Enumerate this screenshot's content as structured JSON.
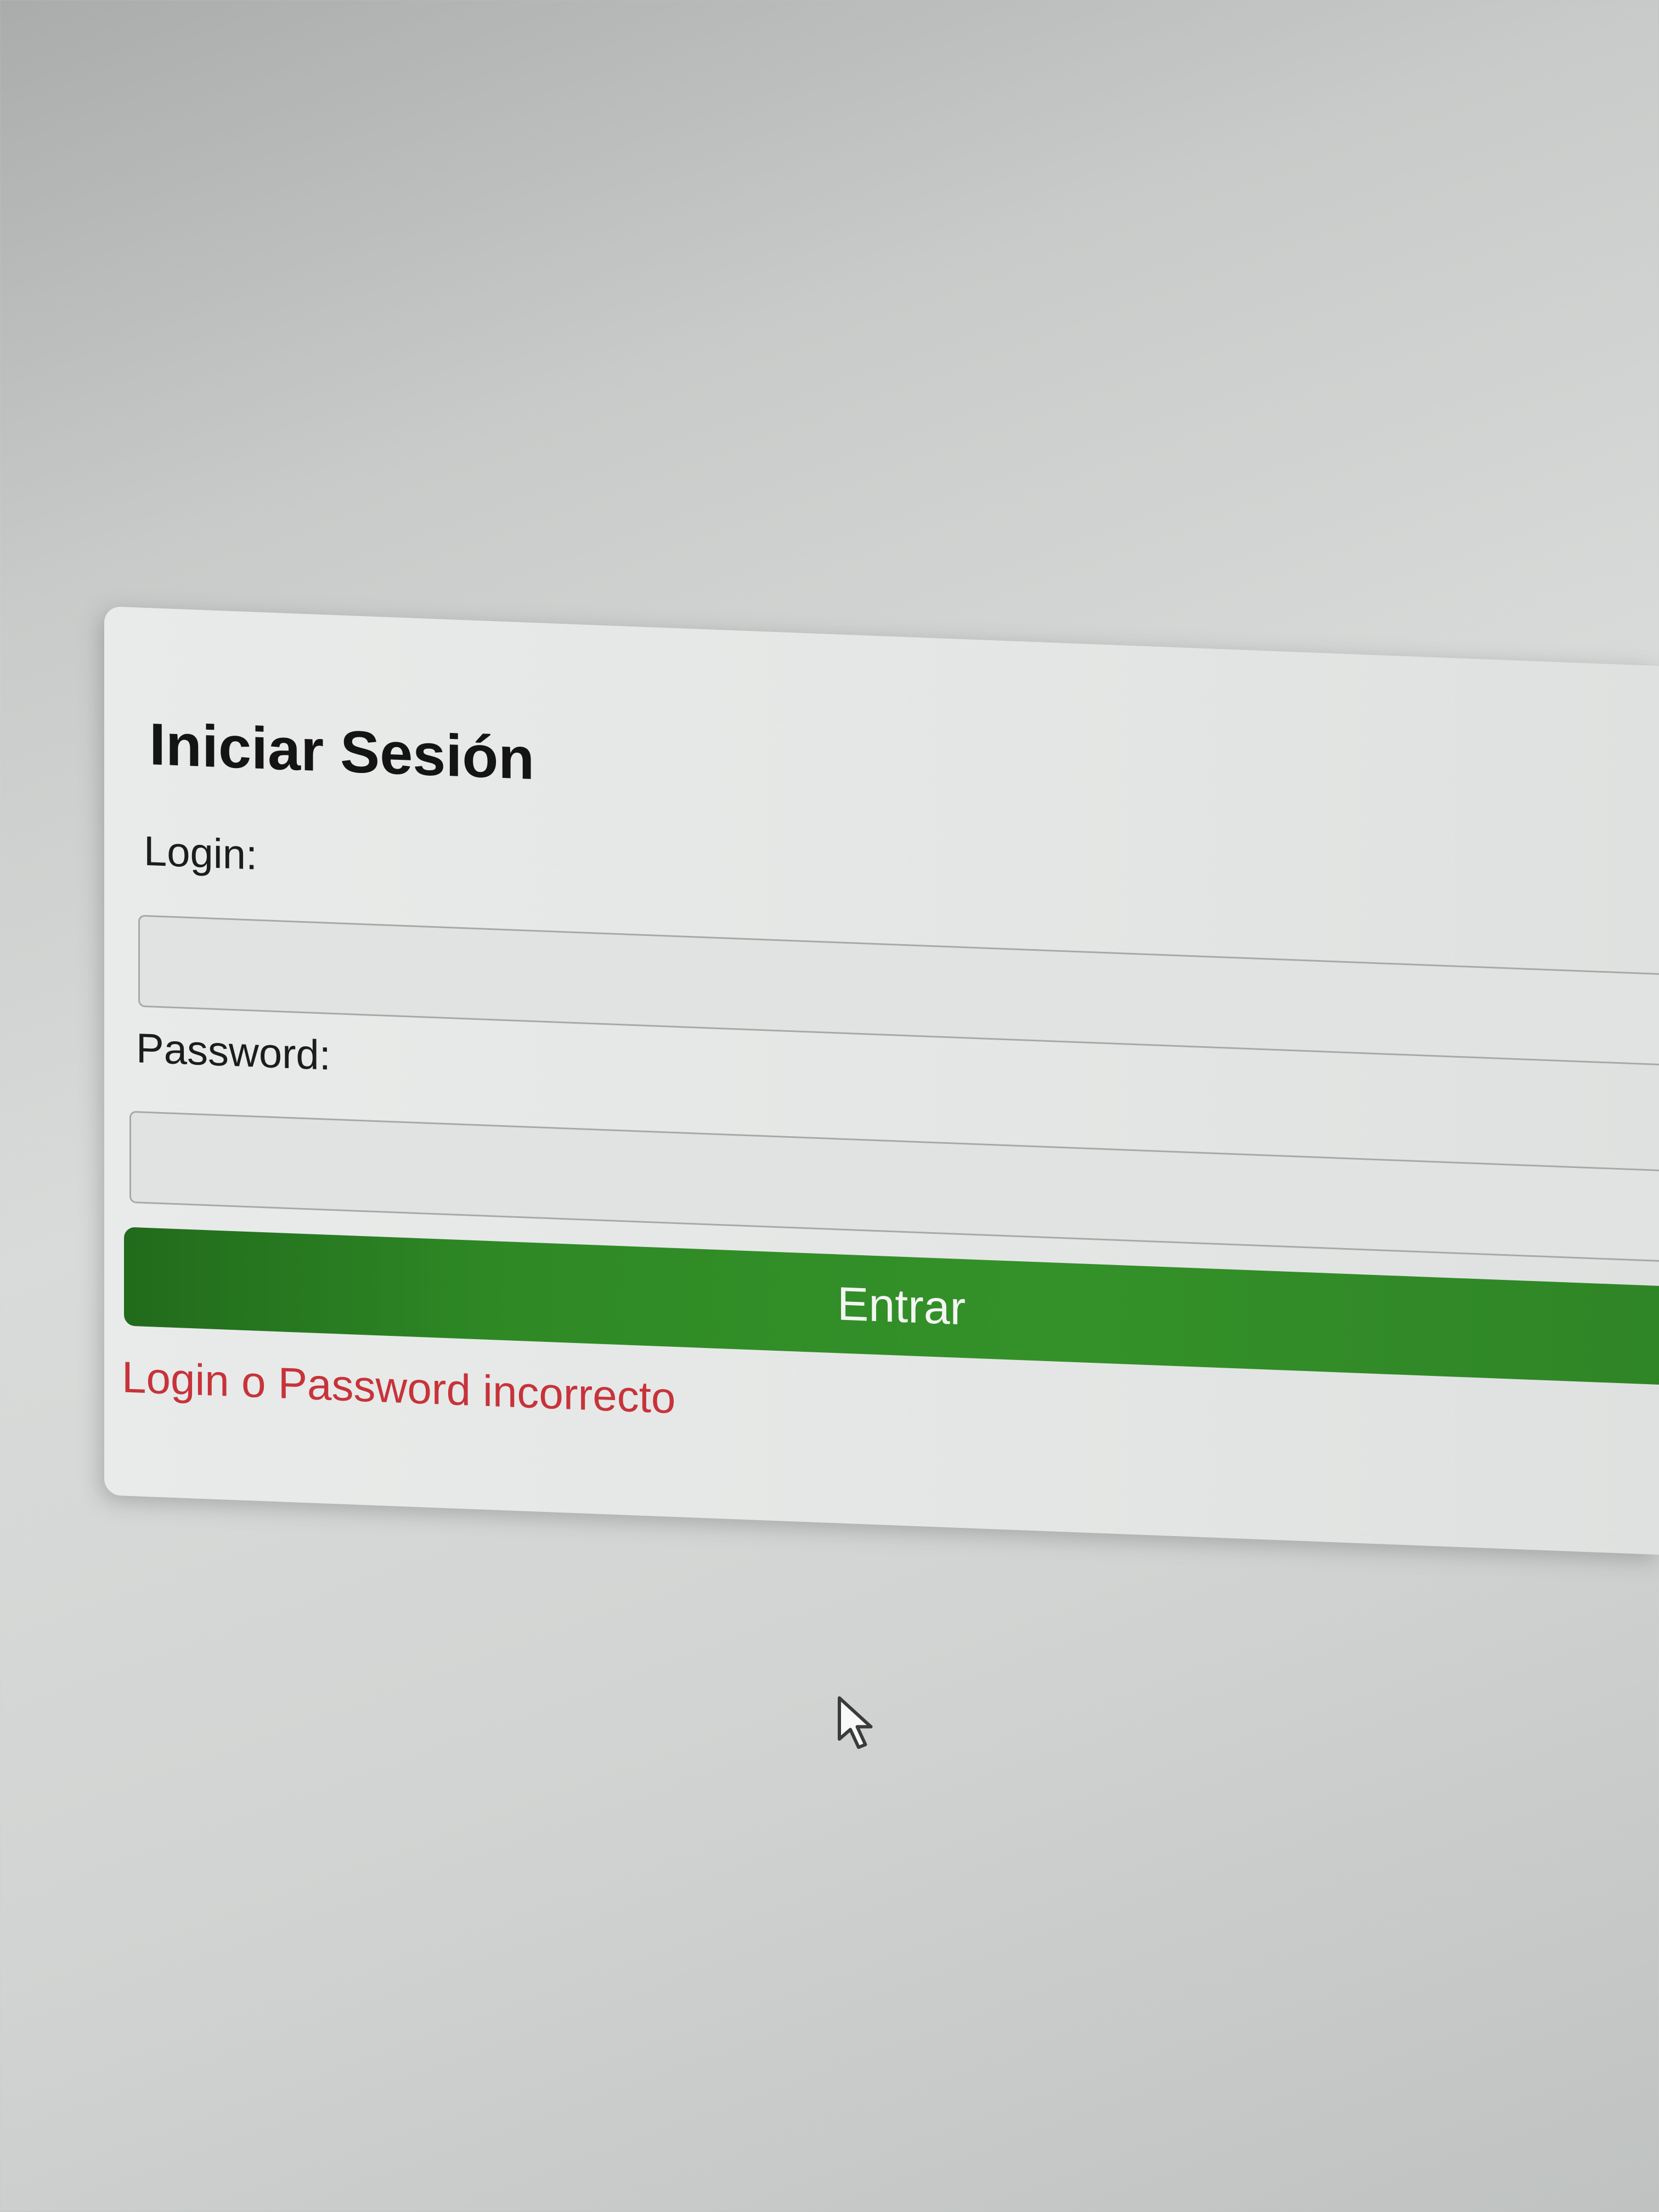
{
  "login_form": {
    "title": "Iniciar Sesión",
    "login_label": "Login:",
    "login_value": "",
    "password_label": "Password:",
    "password_value": "",
    "submit_label": "Entrar",
    "error_message": "Login o Password incorrecto"
  },
  "colors": {
    "button": "#349129",
    "error": "#c7333a",
    "title": "#141414"
  },
  "icons": {
    "cursor": "mouse-pointer-icon"
  }
}
